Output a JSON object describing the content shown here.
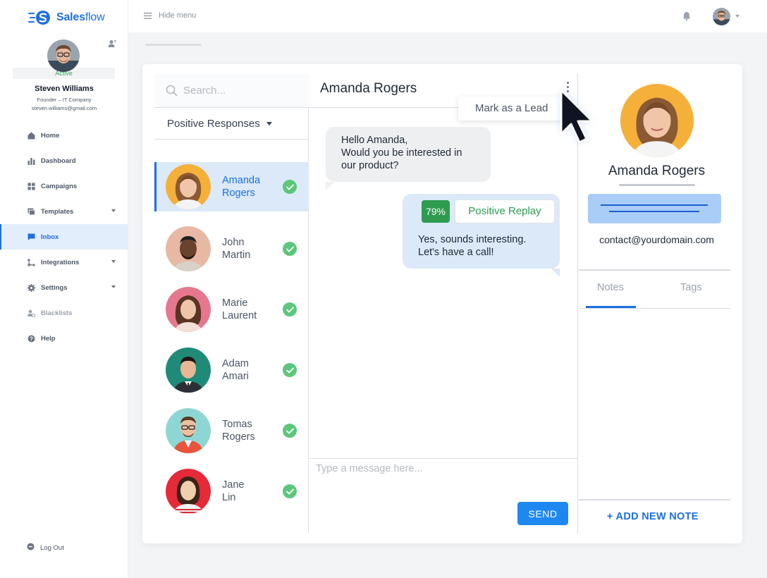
{
  "app": {
    "brand_name_bold": "Sales",
    "brand_name_light": "flow",
    "brand_color": "#1e6fe0"
  },
  "user": {
    "status": "Active",
    "name": "Steven Williams",
    "role": "Founder – IT Company",
    "email": "steven.williams@gmail.com"
  },
  "sidebar": {
    "items": [
      {
        "label": "Home",
        "icon": "home-icon"
      },
      {
        "label": "Dashboard",
        "icon": "bar-chart-icon"
      },
      {
        "label": "Campaigns",
        "icon": "grid-icon"
      },
      {
        "label": "Templates",
        "icon": "templates-icon"
      },
      {
        "label": "Inbox",
        "icon": "chat-icon",
        "active": true
      },
      {
        "label": "Integrations",
        "icon": "integrations-icon"
      },
      {
        "label": "Settings",
        "icon": "gear-icon"
      },
      {
        "label": "Blacklists",
        "icon": "blacklist-icon"
      },
      {
        "label": "Help",
        "icon": "help-icon"
      }
    ],
    "logout": "Log Out"
  },
  "topbar": {
    "hide_menu": "Hide menu"
  },
  "contacts": {
    "search_placeholder": "Search...",
    "filter": "Positive Responses",
    "list": [
      {
        "name_line1": "Amanda",
        "name_line2": "Rogers"
      },
      {
        "name_line1": "John",
        "name_line2": "Martin"
      },
      {
        "name_line1": "Marie",
        "name_line2": "Laurent"
      },
      {
        "name_line1": "Adam",
        "name_line2": "Amari"
      },
      {
        "name_line1": "Tomas",
        "name_line2": "Rogers"
      },
      {
        "name_line1": "Jane",
        "name_line2": "Lin"
      }
    ]
  },
  "chat": {
    "title": "Amanda Rogers",
    "mark_as_lead": "Mark as a Lead",
    "incoming_lines": [
      "Hello Amanda,",
      "Would you be interested in",
      "our product?"
    ],
    "score": "79%",
    "sentiment": "Positive Replay",
    "outgoing_lines": [
      "Yes, sounds interesting.",
      "Let's have a call!"
    ],
    "composer_placeholder": "Type a message here...",
    "send_label": "SEND"
  },
  "profile": {
    "name": "Amanda Rogers",
    "email": "contact@yourdomain.com",
    "tab_notes": "Notes",
    "tab_tags": "Tags",
    "add_note": "+ ADD NEW NOTE"
  }
}
